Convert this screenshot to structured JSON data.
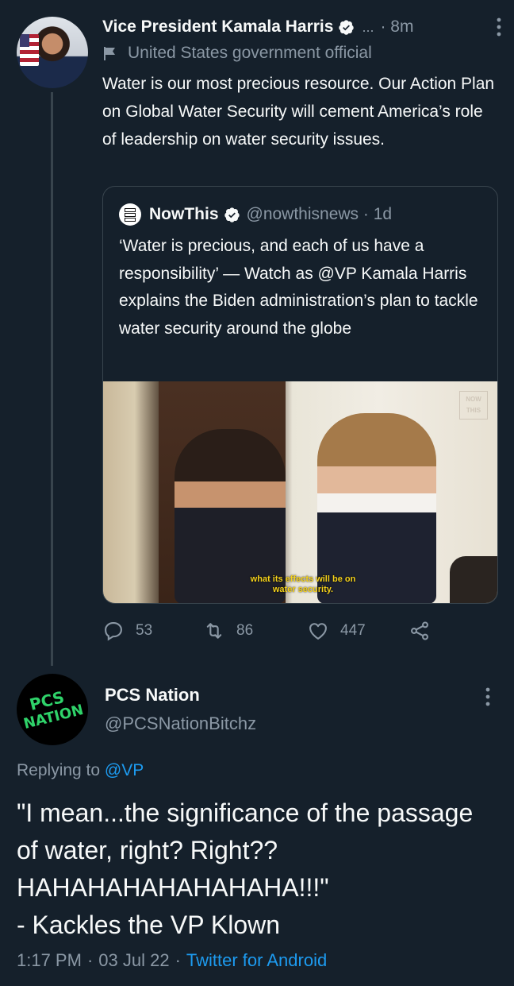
{
  "tweet": {
    "author_name": "Vice President Kamala Harris",
    "ellipsis": "...",
    "time": "· 8m",
    "label": "United States government official",
    "text": "Water is our most precious resource. Our Action Plan on Global Water Security will cement America’s role of leadership on water security issues.",
    "quote": {
      "author_name": "NowThis",
      "handle_time": "@nowthisnews · 1d",
      "text": "‘Water is precious, and each of us have a responsibility’ — Watch as @VP Kamala Harris explains the Biden administration’s plan to tackle water security around the globe",
      "video_caption": "what its effects will be on water security.",
      "video_logo_top": "NOW",
      "video_logo_bottom": "THIS"
    },
    "stats": {
      "replies": "53",
      "retweets": "86",
      "likes": "447"
    }
  },
  "reply": {
    "author_name": "PCS Nation",
    "handle": "@PCSNationBitchz",
    "avatar_text_1": "PCS",
    "avatar_text_2": "NATION",
    "replying_prefix": "Replying to",
    "replying_to": "@VP",
    "text": "\"I mean...the significance of the passage of water, right? Right?? HAHAHAHAHAHAHAHA!!!\"\n- Kackles the VP Klown",
    "time": "1:17 PM",
    "date": "03 Jul 22",
    "source": "Twitter for Android",
    "separator": "·"
  },
  "colors": {
    "background": "#15202b",
    "text": "#f7f9f9",
    "muted": "#8b98a5",
    "accent": "#1d9bf0",
    "border": "#38444d"
  }
}
